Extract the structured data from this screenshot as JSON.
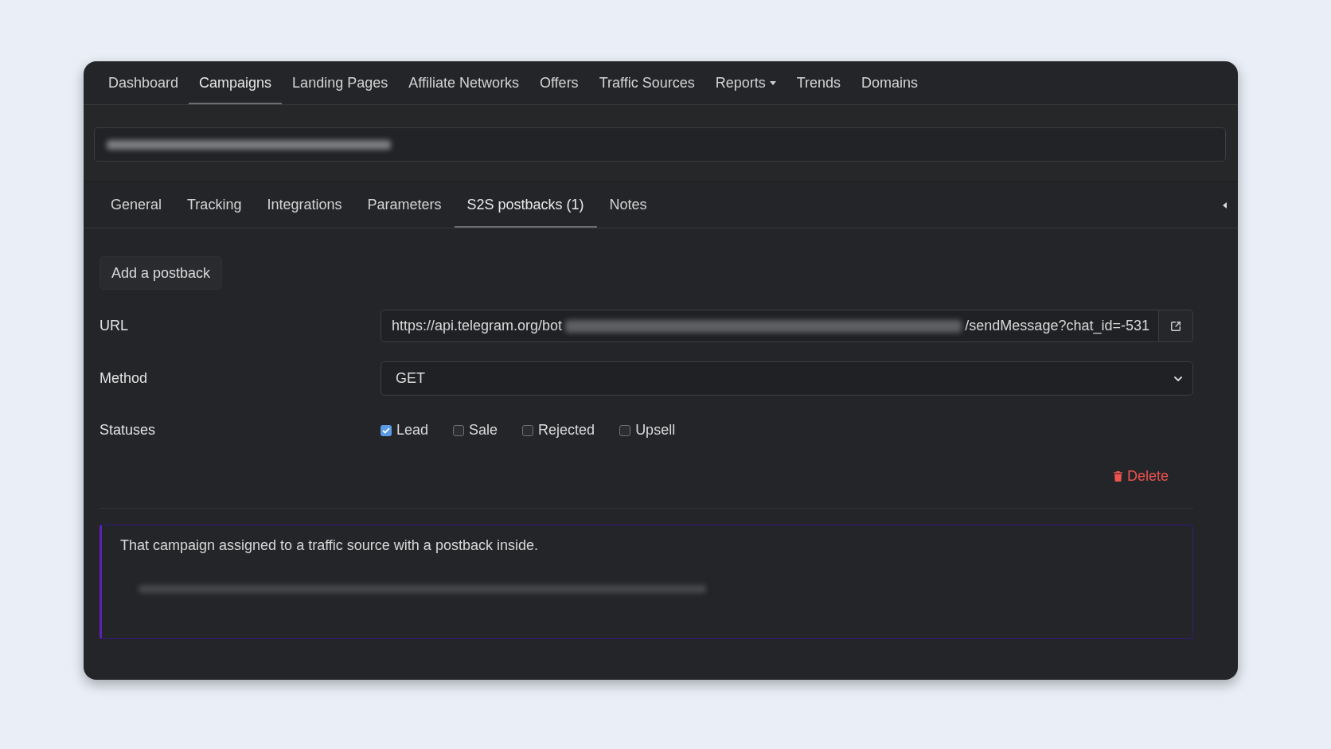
{
  "nav": [
    {
      "label": "Dashboard",
      "selected": false,
      "dropdown": false
    },
    {
      "label": "Campaigns",
      "selected": true,
      "dropdown": false
    },
    {
      "label": "Landing Pages",
      "selected": false,
      "dropdown": false
    },
    {
      "label": "Affiliate Networks",
      "selected": false,
      "dropdown": false
    },
    {
      "label": "Offers",
      "selected": false,
      "dropdown": false
    },
    {
      "label": "Traffic Sources",
      "selected": false,
      "dropdown": false
    },
    {
      "label": "Reports",
      "selected": false,
      "dropdown": true
    },
    {
      "label": "Trends",
      "selected": false,
      "dropdown": false
    },
    {
      "label": "Domains",
      "selected": false,
      "dropdown": false
    }
  ],
  "campaign_field": {
    "value_blurred": true
  },
  "tabs": [
    {
      "label": "General",
      "selected": false
    },
    {
      "label": "Tracking",
      "selected": false
    },
    {
      "label": "Integrations",
      "selected": false
    },
    {
      "label": "Parameters",
      "selected": false
    },
    {
      "label": "S2S postbacks (1)",
      "selected": true
    },
    {
      "label": "Notes",
      "selected": false
    }
  ],
  "postback": {
    "add_button": "Add a postback",
    "rows": [
      {
        "kind": "url",
        "label": "URL",
        "value_start": "https://api.telegram.org/bot",
        "value_blurred": true,
        "value_end": "/sendMessage?chat_id=-531"
      },
      {
        "kind": "select",
        "label": "Method",
        "value": "GET"
      },
      {
        "kind": "checkboxes",
        "label": "Statuses",
        "options": [
          {
            "label": "Lead",
            "checked": true
          },
          {
            "label": "Sale",
            "checked": false
          },
          {
            "label": "Rejected",
            "checked": false
          },
          {
            "label": "Upsell",
            "checked": false
          }
        ]
      }
    ],
    "delete_button": "Delete"
  },
  "note": {
    "text": "That campaign assigned to a traffic source with a postback inside.",
    "link_blurred": true
  }
}
